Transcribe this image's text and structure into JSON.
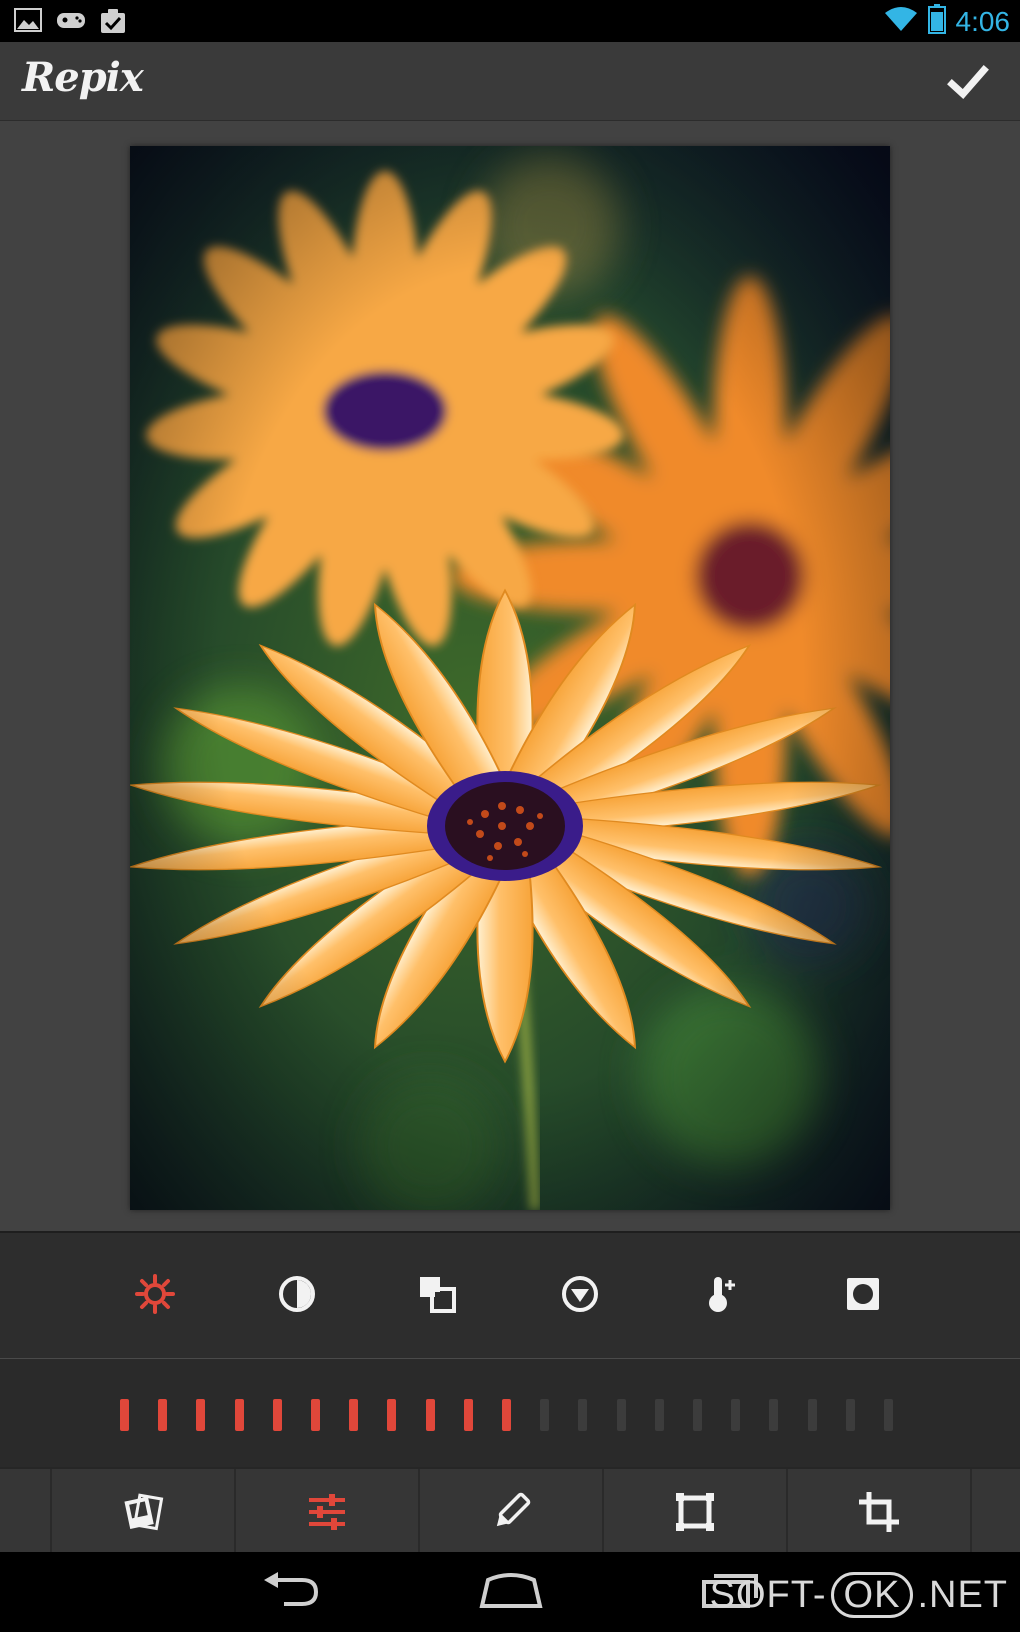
{
  "status_bar": {
    "time": "4:06",
    "left_icons": [
      "image-icon",
      "gamepad-icon",
      "clipboard-check-icon"
    ],
    "right_icons": [
      "wifi-icon",
      "battery-icon"
    ]
  },
  "action_bar": {
    "title": "Repix",
    "confirm_icon": "checkmark-icon"
  },
  "photo": {
    "subject": "orange-daisy-photo"
  },
  "adjust_tools": [
    {
      "icon": "brightness-sun-icon",
      "active": true
    },
    {
      "icon": "contrast-icon",
      "active": false
    },
    {
      "icon": "saturation-squares-icon",
      "active": false
    },
    {
      "icon": "vignette-triangle-icon",
      "active": false
    },
    {
      "icon": "temperature-thermometer-icon",
      "active": false
    },
    {
      "icon": "vignette-square-icon",
      "active": false
    }
  ],
  "slider": {
    "total_ticks": 21,
    "active_ticks": 11,
    "active_color": "#e0473a",
    "inactive_color": "#3c3c3c"
  },
  "bottom_tools": [
    {
      "icon": "photos-stack-icon",
      "active": false
    },
    {
      "icon": "adjust-sliders-icon",
      "active": true
    },
    {
      "icon": "pencil-brush-icon",
      "active": false
    },
    {
      "icon": "frame-icon",
      "active": false
    },
    {
      "icon": "crop-icon",
      "active": false
    }
  ],
  "nav_bar": {
    "icons": [
      "back-icon",
      "home-icon",
      "recent-apps-icon"
    ]
  },
  "watermark": {
    "prefix": "SOFT-",
    "boxed": "OK",
    "suffix": ".NET"
  },
  "colors": {
    "accent": "#e0473a",
    "clock": "#33b5e5",
    "icon": "#f2f2f2"
  }
}
